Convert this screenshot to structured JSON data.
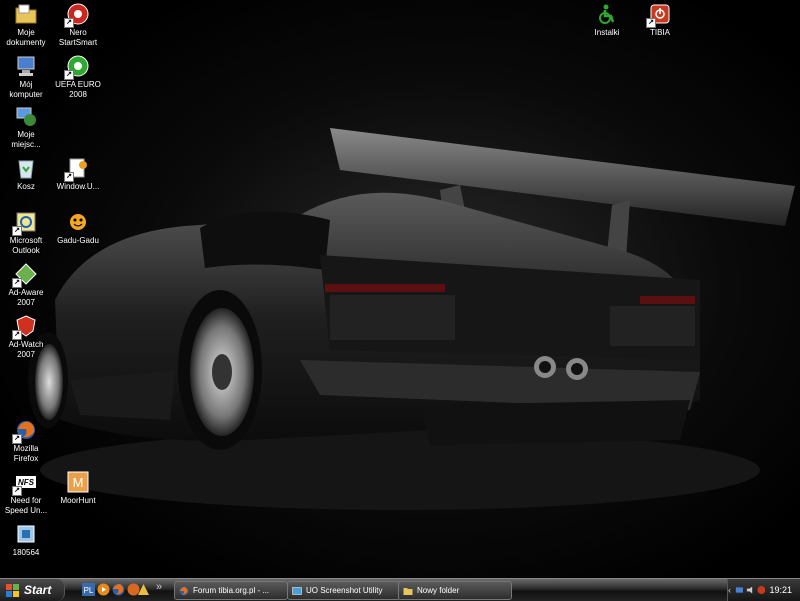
{
  "desktop": {
    "icons": [
      {
        "label": "Moje\ndokumenty",
        "icon": "folder-documents-icon"
      },
      {
        "label": "Nero\nStartSmart",
        "icon": "nero-icon"
      },
      {
        "label": "Mój\nkomputer",
        "icon": "computer-icon"
      },
      {
        "label": "UEFA EURO\n2008",
        "icon": "football-icon"
      },
      {
        "label": "Moje\nmiejsc...",
        "icon": "network-places-icon"
      },
      {
        "label": "Kosz",
        "icon": "recycle-bin-icon"
      },
      {
        "label": "Window.U...",
        "icon": "window-utility-icon"
      },
      {
        "label": "Microsoft\nOutlook",
        "icon": "outlook-icon"
      },
      {
        "label": "Gadu-Gadu",
        "icon": "gadu-gadu-icon"
      },
      {
        "label": "Ad-Aware\n2007",
        "icon": "ad-aware-icon"
      },
      {
        "label": "Ad-Watch\n2007",
        "icon": "ad-watch-icon"
      },
      {
        "label": "Mozilla\nFirefox",
        "icon": "firefox-icon"
      },
      {
        "label": "Need for\nSpeed Un...",
        "icon": "nfs-icon"
      },
      {
        "label": "MoorHunt",
        "icon": "moorhunt-icon"
      },
      {
        "label": "180564",
        "icon": "installer-icon"
      },
      {
        "label": "Instalki",
        "icon": "accessibility-icon"
      },
      {
        "label": "TIBIA",
        "icon": "tibia-icon"
      }
    ],
    "wallpaper": "black-sports-car"
  },
  "taskbar": {
    "start_label": "Start",
    "overflow_label": "»",
    "tasks": [
      {
        "label": "Forum tibia.org.pl - ...",
        "icon": "firefox-icon"
      },
      {
        "label": "UO Screenshot Utility",
        "icon": "screenshot-app-icon"
      },
      {
        "label": "Nowy folder",
        "icon": "folder-icon"
      }
    ],
    "tray": {
      "clock": "19:21"
    }
  },
  "colors": {
    "folder": "#e8c55a",
    "accent_green": "#2fa82f",
    "tibia_red": "#c83a1e"
  }
}
